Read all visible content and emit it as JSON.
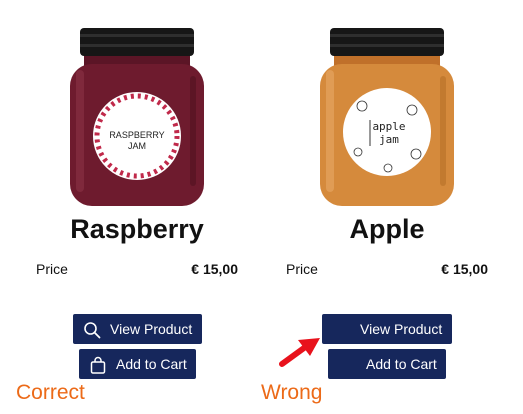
{
  "colors": {
    "button_bg": "#16275c",
    "button_text": "#ffffff",
    "caption": "#ec6a18",
    "arrow": "#e8121c"
  },
  "products": [
    {
      "title": "Raspberry",
      "jar_label_lines": [
        "RASPBERRY",
        "JAM"
      ],
      "price_label": "Price",
      "price_value": "€ 15,00",
      "view_button_label": "View Product",
      "cart_button_label": "Add to Cart",
      "icons": [
        "search-icon",
        "shopping-bag-icon"
      ]
    },
    {
      "title": "Apple",
      "jar_label_lines": [
        "apple",
        "jam"
      ],
      "price_label": "Price",
      "price_value": "€ 15,00",
      "view_button_label": "View Product",
      "cart_button_label": "Add to Cart",
      "icons": []
    }
  ],
  "captions": {
    "left": "Correct",
    "right": "Wrong"
  }
}
